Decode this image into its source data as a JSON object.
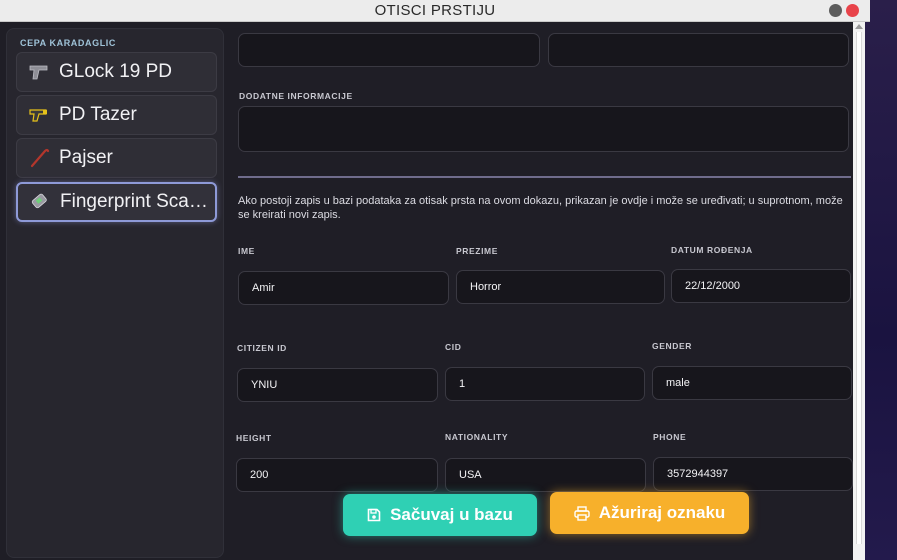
{
  "window": {
    "title": "OTISCI PRSTIJU"
  },
  "sidebar": {
    "title": "CEPA KARADAGLIC",
    "items": [
      {
        "label": "GLock 19 PD",
        "icon": "pistol-icon"
      },
      {
        "label": "PD Tazer",
        "icon": "taser-icon"
      },
      {
        "label": "Pajser",
        "icon": "crowbar-icon"
      },
      {
        "label": "Fingerprint Sca…",
        "icon": "fingerprint-scanner-icon"
      }
    ]
  },
  "form": {
    "top_field_1": "",
    "top_field_2": "",
    "dodatne_label": "DODATNE INFORMACIJE",
    "dodatne_value": "",
    "info_text": "Ako postoji zapis u bazi podataka za otisak prsta na ovom dokazu, prikazan je ovdje i može se uređivati; u suprotnom, može se kreirati novi zapis.",
    "ime": {
      "label": "IME",
      "value": "Amir"
    },
    "prezime": {
      "label": "PREZIME",
      "value": "Horror"
    },
    "datum": {
      "label": "DATUM ROĐENJA",
      "value": "22/12/2000"
    },
    "citizen_id": {
      "label": "CITIZEN ID",
      "value": "YNIU"
    },
    "cid": {
      "label": "CID",
      "value": "1"
    },
    "gender": {
      "label": "GENDER",
      "value": "male"
    },
    "height": {
      "label": "HEIGHT",
      "value": "200"
    },
    "nationality": {
      "label": "NATIONALITY",
      "value": "USA"
    },
    "phone": {
      "label": "PHONE",
      "value": "3572944397"
    }
  },
  "buttons": {
    "save_label": "Sačuvaj u bazu",
    "update_label": "Ažuriraj oznaku"
  },
  "colors": {
    "save": "#2fd0b4",
    "update": "#f7b02b",
    "active_border": "#8e9ad8"
  }
}
